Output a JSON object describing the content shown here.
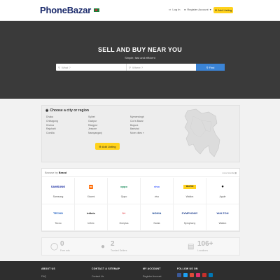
{
  "header": {
    "logo": "PhoneBazar",
    "login": "Log In",
    "register": "Register Account",
    "add_listing": "Add Listing"
  },
  "hero": {
    "title": "SELL AND BUY NEAR YOU",
    "subtitle": "Simple, fast and efficient",
    "what_placeholder": "What ?",
    "where_placeholder": "Where ?",
    "find": "Find"
  },
  "cities": {
    "title": "Choose a city or region",
    "col1": [
      "Dhaka",
      "Chittagong",
      "Khulna",
      "Rajshahi",
      "Comilla"
    ],
    "col2": [
      "Sylhet",
      "Gazipur",
      "Rangpur",
      "Jessore",
      "Narayanganj"
    ],
    "col3": [
      "Mymensingh",
      "Cox's Bazar",
      "Bogura",
      "Barishal",
      "More cities »"
    ],
    "add_listing": "Add Listing"
  },
  "brands": {
    "head_prefix": "Browse by",
    "head_bold": "Brand",
    "more": "more brands",
    "items": [
      {
        "logo": "SAMSUNG",
        "name": "Samsung",
        "color": "#1428a0"
      },
      {
        "logo": "mi",
        "name": "Xiaomi",
        "color": "#ff6900"
      },
      {
        "logo": "oppo",
        "name": "Oppo",
        "color": "#1a8c5b"
      },
      {
        "logo": "vivo",
        "name": "vivo",
        "color": "#415fff"
      },
      {
        "logo": "WALTON",
        "name": "Walton",
        "color": "#e0b400"
      },
      {
        "logo": "",
        "name": "Apple",
        "color": "#111111"
      },
      {
        "logo": "TECNO",
        "name": "Tecno",
        "color": "#1b5cbf"
      },
      {
        "logo": "infinix",
        "name": "Infinix",
        "color": "#111111"
      },
      {
        "logo": "1+",
        "name": "Oneplus",
        "color": "#e0252d"
      },
      {
        "logo": "NOKIA",
        "name": "Nokia",
        "color": "#124191"
      },
      {
        "logo": "SYMPHONY",
        "name": "Symphony",
        "color": "#1c3c8c"
      },
      {
        "logo": "WALTON",
        "name": "Walton",
        "color": "#2b4a9b"
      }
    ]
  },
  "stats": [
    {
      "num": "0",
      "label": "Free ads"
    },
    {
      "num": "2",
      "label": "Trusted Sellers"
    },
    {
      "num": "106+",
      "label": "Locations"
    }
  ],
  "footer": {
    "about": "ABOUT US",
    "about_item": "FAQ",
    "contact": "CONTACT & SITEMAP",
    "contact_item": "Contact Us",
    "account": "MY ACCOUNT",
    "account_item": "Register Account",
    "follow": "FOLLOW US ON",
    "social_colors": [
      "#3b5998",
      "#1da1f2",
      "#dd4b39",
      "#e1306c",
      "#c4302b",
      "#0077b5"
    ]
  }
}
